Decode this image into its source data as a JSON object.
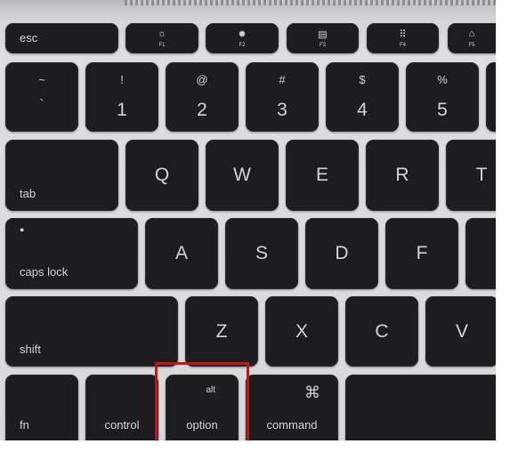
{
  "keyboard": {
    "function_row": {
      "esc": "esc",
      "f1": "F1",
      "f2": "F2",
      "f3": "F3",
      "f4": "F4",
      "f5": "F5"
    },
    "number_row": [
      {
        "top": "~",
        "bottom": "`"
      },
      {
        "top": "!",
        "bottom": "1"
      },
      {
        "top": "@",
        "bottom": "2"
      },
      {
        "top": "#",
        "bottom": "3"
      },
      {
        "top": "$",
        "bottom": "4"
      },
      {
        "top": "%",
        "bottom": "5"
      }
    ],
    "qwerty_row": {
      "tab": "tab",
      "keys": [
        "Q",
        "W",
        "E",
        "R",
        "T"
      ]
    },
    "home_row": {
      "caps": "caps lock",
      "keys": [
        "A",
        "S",
        "D",
        "F"
      ]
    },
    "shift_row": {
      "shift": "shift",
      "keys": [
        "Z",
        "X",
        "C",
        "V"
      ]
    },
    "bottom_row": {
      "fn": "fn",
      "control": "control",
      "option_alt": "alt",
      "option": "option",
      "command_symbol": "⌘",
      "command": "command"
    },
    "highlight_color": "#c0161b",
    "highlighted_key": "option"
  }
}
